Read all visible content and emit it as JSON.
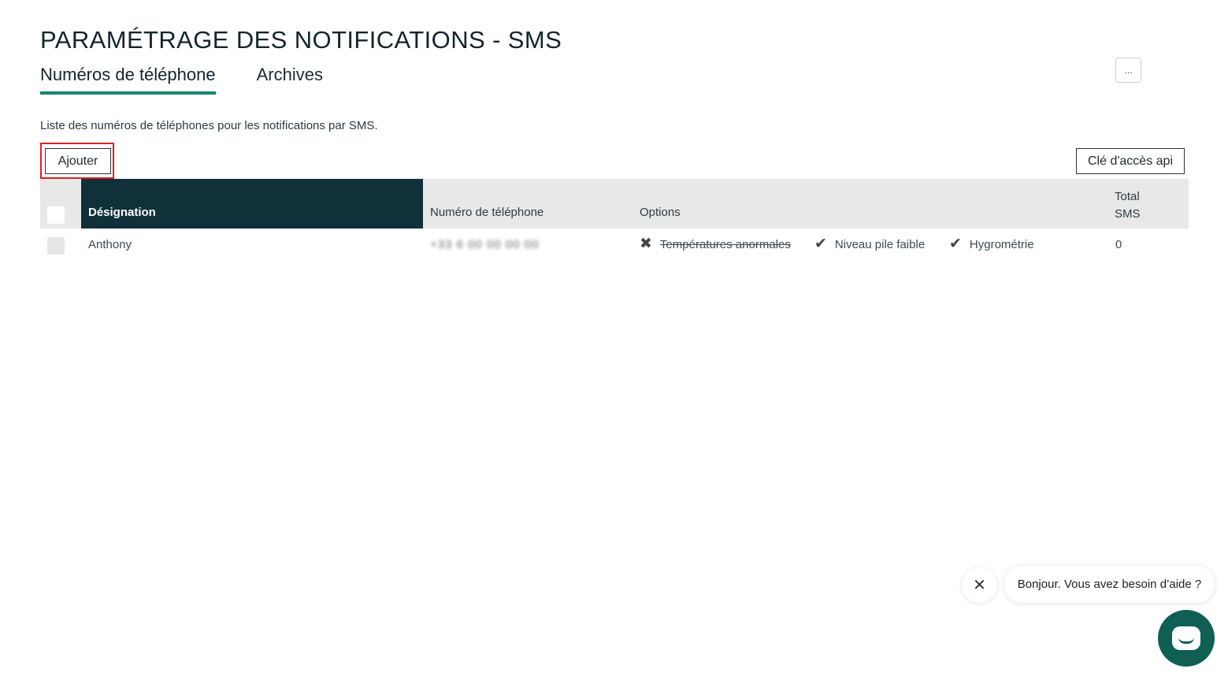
{
  "page": {
    "title": "PARAMÉTRAGE DES NOTIFICATIONS - SMS",
    "description": "Liste des numéros de téléphones pour les notifications par SMS."
  },
  "tabs": [
    {
      "label": "Numéros de téléphone",
      "active": true
    },
    {
      "label": "Archives",
      "active": false
    }
  ],
  "actions": {
    "add_label": "Ajouter",
    "api_key_label": "Clé d'accès api"
  },
  "table": {
    "columns": {
      "designation": "Désignation",
      "phone": "Numéro de téléphone",
      "options": "Options",
      "total_line1": "Total",
      "total_line2": "SMS"
    },
    "rows": [
      {
        "designation": "Anthony",
        "phone": "+33 6 00 00 00 00",
        "options": [
          {
            "label": "Températures anormales",
            "enabled": false,
            "icon": "cross-icon"
          },
          {
            "label": "Niveau pile faible",
            "enabled": true,
            "icon": "check-icon"
          },
          {
            "label": "Hygrométrie",
            "enabled": true,
            "icon": "check-icon"
          }
        ],
        "total_sms": "0",
        "more_label": "..."
      }
    ]
  },
  "chat": {
    "greeting": "Bonjour. Vous avez besoin d’aide ?",
    "close_icon": "close-icon",
    "launcher_icon": "chat-icon"
  },
  "colors": {
    "accent": "#17856e",
    "header_dark": "#10303a",
    "chat_launcher": "#0f5f54",
    "highlight": "#e02020"
  }
}
